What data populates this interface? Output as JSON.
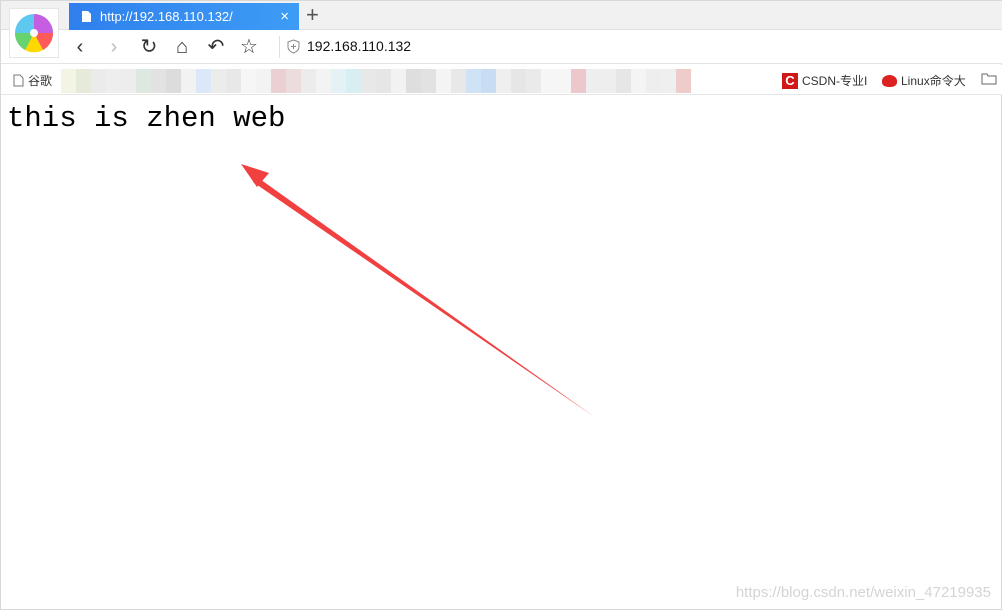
{
  "tab": {
    "title": "http://192.168.110.132/",
    "close_icon": "close-icon"
  },
  "navbar": {
    "url": "192.168.110.132"
  },
  "bookmarks": [
    {
      "label": "谷歌"
    },
    {
      "label": "CSDN-专业I"
    },
    {
      "label": "Linux命令大"
    }
  ],
  "page": {
    "text": "this is zhen web"
  },
  "watermark": "https://blog.csdn.net/weixin_47219935",
  "colors": {
    "tab": "#3d8ff0",
    "arrow": "#f04040",
    "csdn": "#d01818"
  }
}
